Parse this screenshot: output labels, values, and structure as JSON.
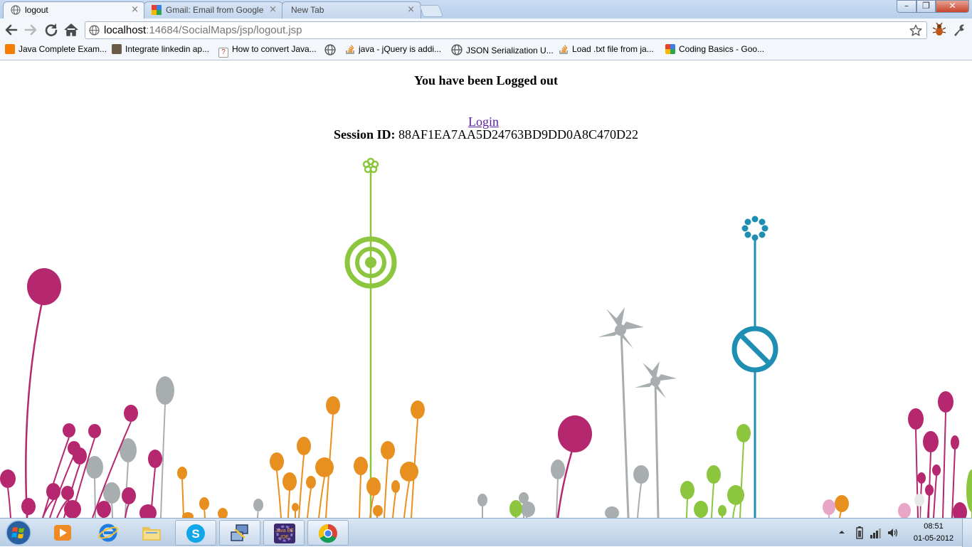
{
  "browser": {
    "tabs": [
      {
        "title": "logout",
        "close": "×",
        "active": true
      },
      {
        "title": "Gmail: Email from Google",
        "close": "×",
        "active": false
      },
      {
        "title": "New Tab",
        "close": "×",
        "active": false
      }
    ],
    "window_buttons": {
      "minimize": "–",
      "maximize": "❐",
      "close": "✕"
    },
    "url_host": "localhost",
    "url_path": ":14684/SocialMaps/jsp/logout.jsp",
    "bookmarks": [
      {
        "label": "Java Complete Exam...",
        "icon": "blogger-icon",
        "color": "#f57d00"
      },
      {
        "label": "Integrate linkedin ap...",
        "icon": "avatar-icon",
        "color": "#6b5a45"
      },
      {
        "label": "How to convert Java...",
        "icon": "question-page-icon",
        "color": "#c0392b"
      },
      {
        "label": "",
        "icon": "globe-icon",
        "color": "#777777"
      },
      {
        "label": "java - jQuery is addi...",
        "icon": "stackoverflow-icon",
        "color": "#e8891d"
      },
      {
        "label": "JSON Serialization U...",
        "icon": "globe-icon",
        "color": "#777777"
      },
      {
        "label": "Load .txt file from ja...",
        "icon": "stackoverflow-icon",
        "color": "#e8891d"
      },
      {
        "label": "Coding Basics - Goo...",
        "icon": "google-icon",
        "color": "#3c7be0"
      }
    ]
  },
  "page": {
    "heading": "You have been Logged out",
    "login_link": "Login ",
    "session_label": "Session ID:",
    "session_value": " 88AF1EA7AA5D24763BD9DD0A8C470D22"
  },
  "taskbar": {
    "time": "08:51",
    "date": "01-05-2012",
    "apps": [
      {
        "name": "windows-media-player"
      },
      {
        "name": "internet-explorer"
      },
      {
        "name": "windows-explorer"
      },
      {
        "name": "skype"
      },
      {
        "name": "network-app"
      },
      {
        "name": "java-ee-ide"
      },
      {
        "name": "google-chrome"
      }
    ]
  },
  "colors": {
    "magenta": "#b5286f",
    "green": "#8cc63f",
    "orange": "#e8901f",
    "grey": "#a8aeb0",
    "blue": "#1e8fb3"
  }
}
